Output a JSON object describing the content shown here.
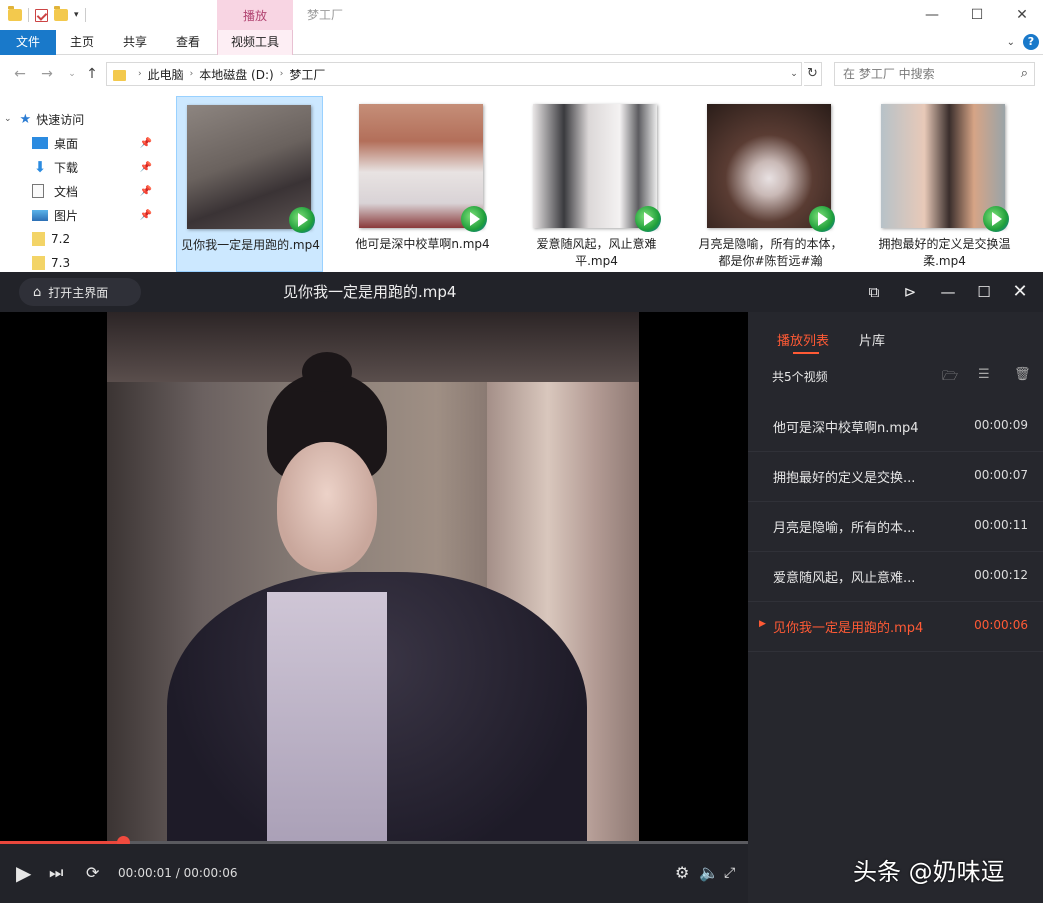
{
  "explorer": {
    "context_tab": "播放",
    "window_title": "梦工厂",
    "window_controls": {
      "minimize": "—",
      "maximize": "☐",
      "close": "✕"
    },
    "ribbon_tabs": [
      "文件",
      "主页",
      "共享",
      "查看",
      "视频工具"
    ],
    "address": {
      "crumbs": [
        "此电脑",
        "本地磁盘 (D:)",
        "梦工厂"
      ]
    },
    "search_placeholder": "在 梦工厂 中搜索",
    "nav": {
      "quick_access": "快速访问",
      "items": [
        "桌面",
        "下载",
        "文档",
        "图片",
        "7.2",
        "7.3"
      ]
    },
    "files": [
      {
        "name": "见你我一定是用跑的.mp4",
        "selected": true
      },
      {
        "name": "他可是深中校草啊n.mp4",
        "selected": false
      },
      {
        "name": "爱意随风起，风止意难平.mp4",
        "selected": false
      },
      {
        "name": "月亮是隐喻，所有的本体，都是你#陈哲远#瀚",
        "selected": false
      },
      {
        "name": "拥抱最好的定义是交换温柔.mp4",
        "selected": false
      }
    ]
  },
  "player": {
    "home_button": "打开主界面",
    "title": "见你我一定是用跑的.mp4",
    "time_display": "00:00:01 / 00:00:06",
    "progress": 0.165,
    "accent_color": "#ff5a35",
    "sidebar": {
      "tabs": [
        "播放列表",
        "片库"
      ],
      "active_tab": "播放列表",
      "count": "共5个视频",
      "playlist": [
        {
          "name": "他可是深中校草啊n.mp4",
          "duration": "00:00:09",
          "active": false
        },
        {
          "name": "拥抱最好的定义是交换...",
          "duration": "00:00:07",
          "active": false
        },
        {
          "name": "月亮是隐喻，所有的本...",
          "duration": "00:00:11",
          "active": false
        },
        {
          "name": "爱意随风起，风止意难...",
          "duration": "00:00:12",
          "active": false
        },
        {
          "name": "见你我一定是用跑的.mp4",
          "duration": "00:00:06",
          "active": true
        }
      ]
    }
  },
  "watermark": "头条 @奶味逗"
}
